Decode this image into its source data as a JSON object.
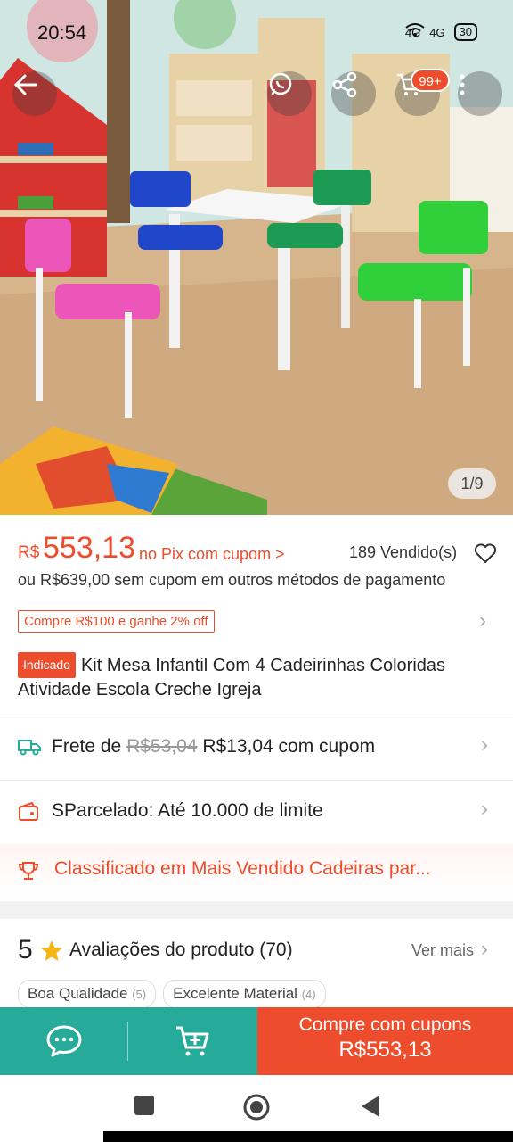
{
  "status_bar": {
    "time": "20:54",
    "network_1": "4G",
    "network_2": "4G",
    "battery": "30"
  },
  "hero": {
    "image_counter": "1/9",
    "cart_badge": "99+"
  },
  "price": {
    "currency": "R$",
    "value": "553,13",
    "pix_note": "no Pix com cupom >",
    "sold": "189 Vendido(s)",
    "alt_price": "ou R$639,00 sem cupom em outros métodos de pagamento"
  },
  "promo": {
    "tag": "Compre R$100 e ganhe 2% off"
  },
  "product": {
    "badge": "Indicado",
    "title": "Kit Mesa Infantil Com 4 Cadeirinhas Coloridas Atividade Escola Creche Igreja"
  },
  "shipping": {
    "label": "Frete de",
    "old_price": "R$53,04",
    "new_price": "R$13,04 com cupom"
  },
  "installment": {
    "label": "SParcelado: Até 10.000 de limite"
  },
  "ranking": {
    "label": "Classificado em Mais Vendido Cadeiras par..."
  },
  "reviews": {
    "rating": "5",
    "title": "Avaliações do produto (70)",
    "see_more": "Ver mais",
    "tags": [
      {
        "label": "Boa Qualidade",
        "count": "(5)"
      },
      {
        "label": "Excelente Material",
        "count": "(4)"
      }
    ]
  },
  "bottom_bar": {
    "buy_label": "Compre com cupons",
    "buy_price": "R$553,13"
  },
  "colors": {
    "accent": "#ee4d2d",
    "teal": "#26aa99"
  }
}
